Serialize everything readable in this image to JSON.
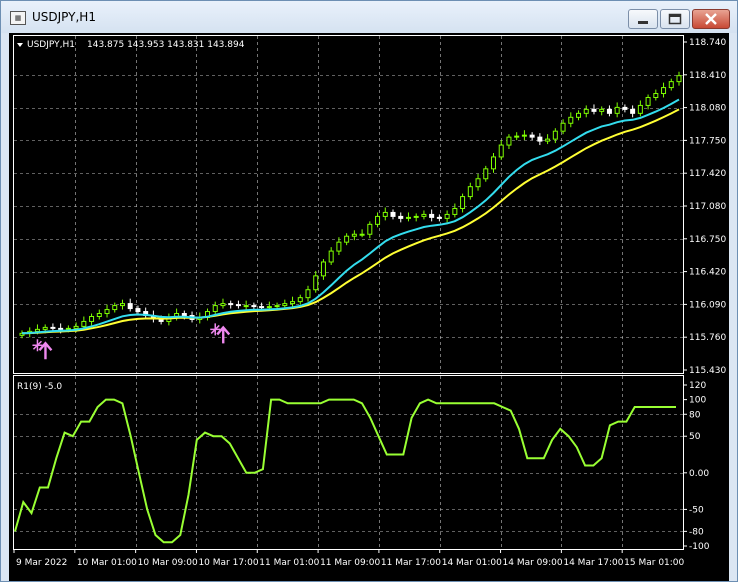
{
  "window": {
    "title": "USDJPY,H1",
    "controls": {
      "minimize": "minimize-icon",
      "maximize": "maximize-icon",
      "close": "close-icon"
    }
  },
  "chart": {
    "info_symbol": "USDJPY,H1",
    "info_ohlc": "143.875 143.953 143.831 143.894",
    "price_labels": [
      "118.740",
      "118.410",
      "118.080",
      "117.750",
      "117.420",
      "117.080",
      "116.750",
      "116.420",
      "116.090",
      "115.760",
      "115.430"
    ],
    "indicator_label": "R1(9) -5.0",
    "indicator_levels": [
      "120",
      "100",
      "80",
      "50",
      "0.00",
      "-50",
      "-80",
      "-100"
    ],
    "time_labels": [
      "9 Mar 2022",
      "10 Mar 01:00",
      "10 Mar 09:00",
      "10 Mar 17:00",
      "11 Mar 01:00",
      "11 Mar 09:00",
      "11 Mar 17:00",
      "14 Mar 01:00",
      "14 Mar 09:00",
      "14 Mar 17:00",
      "15 Mar 01:00"
    ],
    "colors": {
      "background": "#000000",
      "grid": "#c0c0c0",
      "bull": "#7fff00",
      "bear": "#ffffff",
      "ma_fast": "#33ddee",
      "ma_slow": "#ffff33",
      "oscillator": "#99ff33",
      "arrow": "#ee88ee",
      "frame": "#ffffff"
    }
  },
  "chart_data": {
    "type": "candlestick",
    "symbol": "USDJPY",
    "timeframe": "H1",
    "ylim": [
      115.43,
      118.74
    ],
    "close": [
      115.8,
      115.82,
      115.84,
      115.86,
      115.85,
      115.84,
      115.85,
      115.87,
      115.92,
      115.97,
      116.0,
      116.04,
      116.08,
      116.1,
      116.05,
      116.02,
      115.98,
      115.95,
      115.92,
      115.96,
      116.0,
      115.98,
      115.94,
      115.96,
      116.02,
      116.08,
      116.1,
      116.09,
      116.08,
      116.08,
      116.07,
      116.06,
      116.07,
      116.08,
      116.1,
      116.12,
      116.16,
      116.24,
      116.38,
      116.52,
      116.63,
      116.72,
      116.78,
      116.8,
      116.8,
      116.9,
      116.98,
      117.02,
      116.98,
      116.96,
      116.97,
      116.98,
      117.0,
      116.97,
      116.96,
      117.0,
      117.06,
      117.18,
      117.28,
      117.36,
      117.46,
      117.58,
      117.7,
      117.78,
      117.79,
      117.8,
      117.78,
      117.74,
      117.76,
      117.84,
      117.92,
      117.98,
      118.02,
      118.06,
      118.04,
      118.06,
      118.02,
      118.08,
      118.06,
      118.02,
      118.1,
      118.18,
      118.22,
      118.28,
      118.34,
      118.4
    ],
    "ma_fast_end": 118.16,
    "ma_slow_end": 118.06,
    "oscillator": {
      "name": "R1(9) -5.0",
      "ylim": [
        -100,
        120
      ],
      "levels": [
        80,
        50,
        0,
        -50,
        -80
      ],
      "values": [
        -80,
        -40,
        -55,
        -20,
        -20,
        20,
        55,
        50,
        70,
        70,
        90,
        100,
        100,
        95,
        50,
        0,
        -50,
        -85,
        -95,
        -95,
        -85,
        -30,
        45,
        55,
        50,
        50,
        40,
        20,
        0,
        0,
        5,
        100,
        100,
        95,
        95,
        95,
        95,
        95,
        100,
        100,
        100,
        100,
        95,
        75,
        50,
        25,
        25,
        25,
        75,
        95,
        100,
        95,
        95,
        95,
        95,
        95,
        95,
        95,
        95,
        90,
        85,
        60,
        20,
        20,
        20,
        45,
        60,
        50,
        35,
        10,
        10,
        20,
        65,
        70,
        70,
        90,
        90,
        90,
        90,
        90,
        90
      ]
    }
  }
}
